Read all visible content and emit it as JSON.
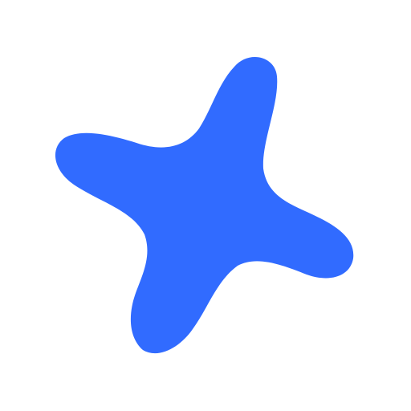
{
  "graphic": {
    "icon": "four-point-blob-star",
    "fill_color": "#316BFF",
    "background_color": "#FFFFFF"
  }
}
